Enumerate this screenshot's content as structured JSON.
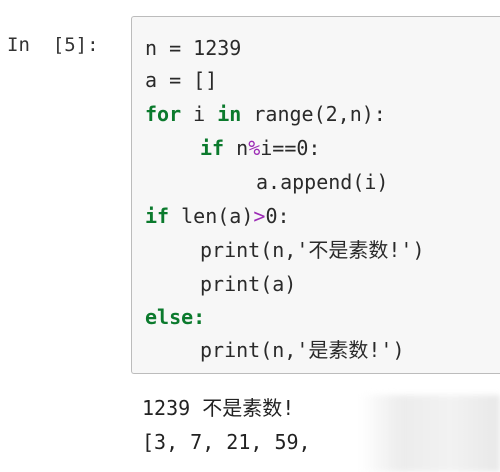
{
  "prompt": "In  [5]:",
  "code": {
    "line1": "n = 1239",
    "line2": "a = []",
    "line3_kw1": "for",
    "line3_mid": " i ",
    "line3_kw2": "in",
    "line3_rest": " range(2,n):",
    "line4_kw": "if",
    "line4_a": " n",
    "line4_op": "%",
    "line4_b": "i==0:",
    "line5": "a.append(i)",
    "line6_kw": "if",
    "line6_a": " len(a)",
    "line6_op": ">",
    "line6_b": "0:",
    "line7": "print(n,'不是素数!')",
    "line8": "print(a)",
    "line9_kw": "else:",
    "line10": "print(n,'是素数!')"
  },
  "output": {
    "line1": "1239 不是素数!",
    "line2": "[3, 7, 21, 59,"
  }
}
